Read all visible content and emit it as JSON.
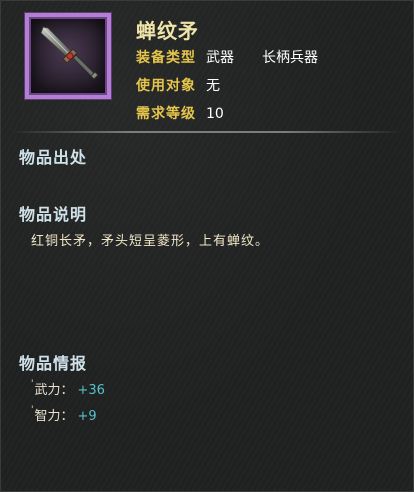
{
  "item": {
    "name": "蝉纹矛",
    "icon": "spear-icon",
    "frame_color": "#b27fd3",
    "attributes": [
      {
        "key": "装备类型",
        "value": "武器",
        "extra": "长柄兵器"
      },
      {
        "key": "使用对象",
        "value": "无"
      },
      {
        "key": "需求等级",
        "value": "10"
      }
    ]
  },
  "sections": {
    "source": {
      "title": "物品出处"
    },
    "description": {
      "title": "物品说明",
      "text": "红铜长矛，矛头短呈菱形，上有蝉纹。"
    },
    "info": {
      "title": "物品情报",
      "stats": [
        {
          "marker": "'",
          "label": "武力：",
          "value": "+36"
        },
        {
          "marker": "'",
          "label": "智力：",
          "value": "+9"
        }
      ]
    }
  },
  "colors": {
    "title": "#f0e5a8",
    "attribute_key": "#e5c54a",
    "section_title": "#cfe2ea",
    "stat_value": "#58c2c9"
  }
}
